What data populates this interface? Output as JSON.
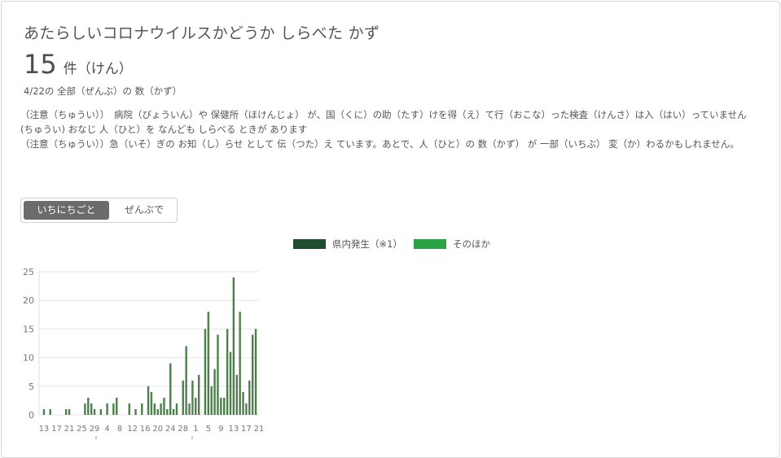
{
  "title": "あたらしいコロナウイルスかどうか しらべた かず",
  "count": {
    "value": "15",
    "unit": "件（けん）"
  },
  "date_line": "4/22の 全部（ぜんぶ）の 数（かず）",
  "notes": [
    "（注意（ちゅうい））　病院（びょういん）や 保健所（ほけんじょ） が、国（くに）の助（たす）けを得（え）て行（おこな）った検査（けんさ）は入（はい）っていません",
    "(ちゅうい) おなじ 人（ひと）を なんども しらべる ときが あります",
    "（注意（ちゅうい））急（いそ）ぎの お知（し）らせ として 伝（つた）え ています。あとで、人（ひと）の 数（かず） が 一部（いちぶ） 変（か）わるかもしれません。"
  ],
  "toggle": {
    "active": "いちにちごと",
    "inactive": "ぜんぶで"
  },
  "colors": {
    "series1": "#1f4d2e",
    "series2": "#2ba244",
    "bar": "#4c7f4c",
    "grid": "#e6e6e6",
    "axis_text": "#777777"
  },
  "chart_data": {
    "type": "bar",
    "series": [
      {
        "name": "県内発生（※1）",
        "color": "#1f4d2e"
      },
      {
        "name": "そのほか",
        "color": "#2ba244"
      }
    ],
    "ylim": [
      0,
      25
    ],
    "yticks": [
      0,
      5,
      10,
      15,
      20,
      25
    ],
    "x_tick_labels": [
      "13",
      "17",
      "21",
      "25",
      "29",
      "4",
      "8",
      "12",
      "16",
      "20",
      "24",
      "28",
      "1",
      "5",
      "9",
      "13",
      "17",
      "21"
    ],
    "values": [
      1,
      0,
      1,
      0,
      0,
      0,
      0,
      1,
      1,
      0,
      0,
      0,
      0,
      2,
      3,
      2,
      1,
      0,
      1,
      0,
      2,
      0,
      2,
      3,
      0,
      0,
      0,
      2,
      0,
      1,
      0,
      2,
      0,
      5,
      4,
      2,
      1,
      2,
      3,
      1,
      9,
      1,
      2,
      0,
      6,
      12,
      2,
      6,
      3,
      7,
      0,
      15,
      18,
      5,
      8,
      14,
      3,
      3,
      15,
      11,
      24,
      7,
      18,
      4,
      2,
      6,
      14,
      15
    ]
  }
}
